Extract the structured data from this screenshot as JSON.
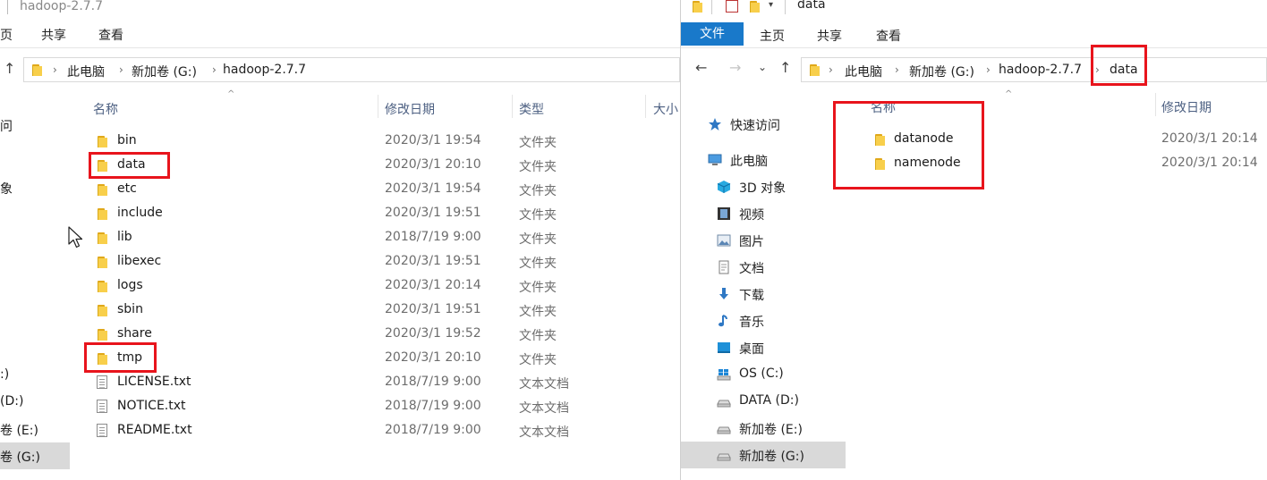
{
  "left_window": {
    "title": "hadoop-2.7.7",
    "menu": {
      "tab_home_partial": "页",
      "share": "共享",
      "view": "查看"
    },
    "address": {
      "crumbs": [
        "此电脑",
        "新加卷 (G:)",
        "hadoop-2.7.7"
      ]
    },
    "columns": {
      "name": "名称",
      "modified": "修改日期",
      "type": "类型",
      "size_partial": "大小"
    },
    "nav_partial": [
      "问",
      "象",
      ":)",
      "(D:)",
      "卷 (E:)",
      "卷 (G:)"
    ],
    "rows": [
      {
        "name": "bin",
        "date": "2020/3/1 19:54",
        "type": "文件夹",
        "kind": "folder"
      },
      {
        "name": "data",
        "date": "2020/3/1 20:10",
        "type": "文件夹",
        "kind": "folder"
      },
      {
        "name": "etc",
        "date": "2020/3/1 19:54",
        "type": "文件夹",
        "kind": "folder"
      },
      {
        "name": "include",
        "date": "2020/3/1 19:51",
        "type": "文件夹",
        "kind": "folder"
      },
      {
        "name": "lib",
        "date": "2018/7/19 9:00",
        "type": "文件夹",
        "kind": "folder"
      },
      {
        "name": "libexec",
        "date": "2020/3/1 19:51",
        "type": "文件夹",
        "kind": "folder"
      },
      {
        "name": "logs",
        "date": "2020/3/1 20:14",
        "type": "文件夹",
        "kind": "folder"
      },
      {
        "name": "sbin",
        "date": "2020/3/1 19:51",
        "type": "文件夹",
        "kind": "folder"
      },
      {
        "name": "share",
        "date": "2020/3/1 19:52",
        "type": "文件夹",
        "kind": "folder"
      },
      {
        "name": "tmp",
        "date": "2020/3/1 20:10",
        "type": "文件夹",
        "kind": "folder"
      },
      {
        "name": "LICENSE.txt",
        "date": "2018/7/19 9:00",
        "type": "文本文档",
        "kind": "file"
      },
      {
        "name": "NOTICE.txt",
        "date": "2018/7/19 9:00",
        "type": "文本文档",
        "kind": "file"
      },
      {
        "name": "README.txt",
        "date": "2018/7/19 9:00",
        "type": "文本文档",
        "kind": "file"
      }
    ]
  },
  "right_window": {
    "title": "data",
    "menu": {
      "file": "文件",
      "home": "主页",
      "share": "共享",
      "view": "查看"
    },
    "address": {
      "crumbs": [
        "此电脑",
        "新加卷 (G:)",
        "hadoop-2.7.7",
        "data"
      ]
    },
    "columns": {
      "name": "名称",
      "modified": "修改日期"
    },
    "nav": [
      {
        "label": "快速访问",
        "icon": "star-icon"
      },
      {
        "label": "此电脑",
        "icon": "computer-icon"
      },
      {
        "label": "3D 对象",
        "icon": "cube-3d-icon"
      },
      {
        "label": "视频",
        "icon": "video-icon"
      },
      {
        "label": "图片",
        "icon": "picture-icon"
      },
      {
        "label": "文档",
        "icon": "document-icon"
      },
      {
        "label": "下载",
        "icon": "download-icon"
      },
      {
        "label": "音乐",
        "icon": "music-icon"
      },
      {
        "label": "桌面",
        "icon": "desktop-icon"
      },
      {
        "label": "OS (C:)",
        "icon": "windows-drive-icon"
      },
      {
        "label": "DATA (D:)",
        "icon": "drive-icon"
      },
      {
        "label": "新加卷 (E:)",
        "icon": "drive-icon"
      },
      {
        "label": "新加卷 (G:)",
        "icon": "drive-icon"
      }
    ],
    "rows": [
      {
        "name": "datanode",
        "date": "2020/3/1 20:14"
      },
      {
        "name": "namenode",
        "date": "2020/3/1 20:14"
      }
    ]
  },
  "colors": {
    "accent": "#1979ca",
    "highlight": "#e8141c",
    "selected_nav": "#d9d9d9",
    "header_text": "#4d6082"
  }
}
